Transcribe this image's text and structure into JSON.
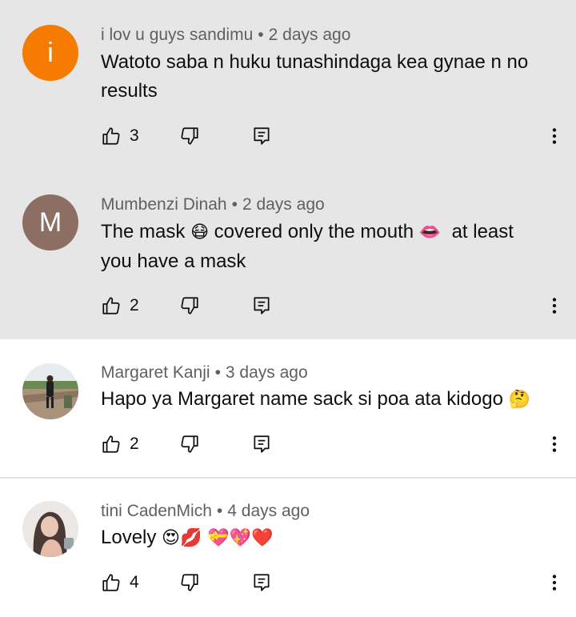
{
  "comments": [
    {
      "avatar_letter": "i",
      "avatar_color": "#f57c00",
      "author": "i lov u guys sandimu",
      "separator": "•",
      "time": "2 days ago",
      "text": "Watoto saba n huku tunashindaga kea gynae n no results",
      "likes": "3"
    },
    {
      "avatar_letter": "M",
      "avatar_color": "#8d6e63",
      "author": "Mumbenzi Dinah",
      "separator": "•",
      "time": "2 days ago",
      "text_part1": "The mask",
      "emoji_mask": "😷",
      "text_part2": "covered only the mouth",
      "emoji_lips": "👄",
      "text_part3": "at least you have a mask",
      "likes": "2"
    },
    {
      "author": "Margaret Kanji",
      "separator": "•",
      "time": "3 days ago",
      "text": "Hapo ya Margaret name sack si poa ata kidogo",
      "emoji_thinking": "🤔",
      "likes": "2"
    },
    {
      "author": "tini CadenMich",
      "separator": "•",
      "time": "4 days ago",
      "text": "Lovely",
      "emojis": "😍💋 💝💖❤️",
      "likes": "4"
    }
  ],
  "icons": {
    "like": "thumbs-up-icon",
    "dislike": "thumbs-down-icon",
    "reply": "reply-comment-icon",
    "more": "more-vertical-icon"
  }
}
